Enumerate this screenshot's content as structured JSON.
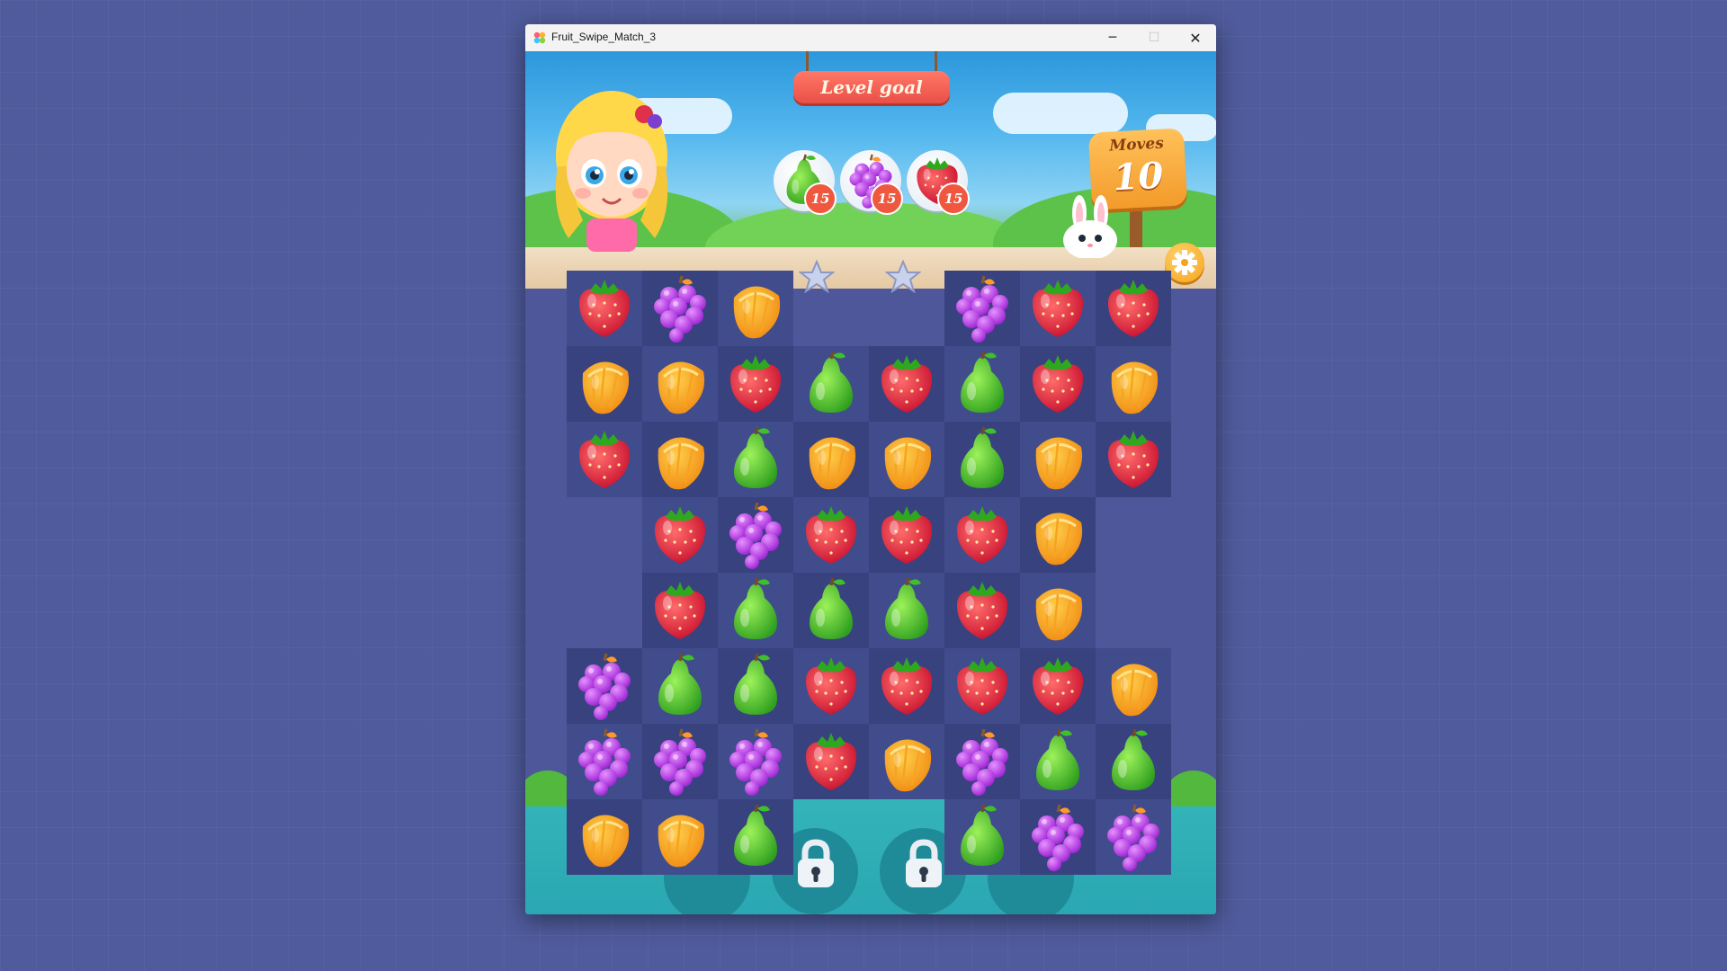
{
  "window": {
    "title": "Fruit_Swipe_Match_3",
    "controls": {
      "minimize": "─",
      "maximize": "☐",
      "close": "✕"
    }
  },
  "hud": {
    "level_goal_label": "Level goal",
    "goals": [
      {
        "fruit": "pear",
        "count": "15"
      },
      {
        "fruit": "grape",
        "count": "15"
      },
      {
        "fruit": "strawberry",
        "count": "15"
      }
    ],
    "moves_label": "Moves",
    "moves_value": "10",
    "settings_icon": "gear-icon"
  },
  "board": {
    "columns": 8,
    "rows": [
      [
        "strawberry",
        "grape",
        "orange",
        null,
        null,
        "grape",
        "strawberry",
        "strawberry"
      ],
      [
        "orange",
        "orange",
        "strawberry",
        "pear",
        "strawberry",
        "pear",
        "strawberry",
        "orange"
      ],
      [
        "strawberry",
        "orange",
        "pear",
        "orange",
        "orange",
        "pear",
        "orange",
        "strawberry"
      ],
      [
        null,
        "strawberry",
        "grape",
        "strawberry",
        "strawberry",
        "strawberry",
        "orange",
        null
      ],
      [
        null,
        "strawberry",
        "pear",
        "pear",
        "pear",
        "strawberry",
        "orange",
        null
      ],
      [
        "grape",
        "pear",
        "pear",
        "strawberry",
        "strawberry",
        "strawberry",
        "strawberry",
        "orange"
      ],
      [
        "grape",
        "grape",
        "grape",
        "strawberry",
        "orange",
        "grape",
        "pear",
        "pear"
      ],
      [
        "orange",
        "orange",
        "pear",
        null,
        null,
        "pear",
        "grape",
        "grape"
      ]
    ],
    "locked_slots": 4
  },
  "colors": {
    "background": "#4f5b9c",
    "board": "#4d5799",
    "sign": "#ea4f46",
    "moves": "#f39b2b"
  }
}
